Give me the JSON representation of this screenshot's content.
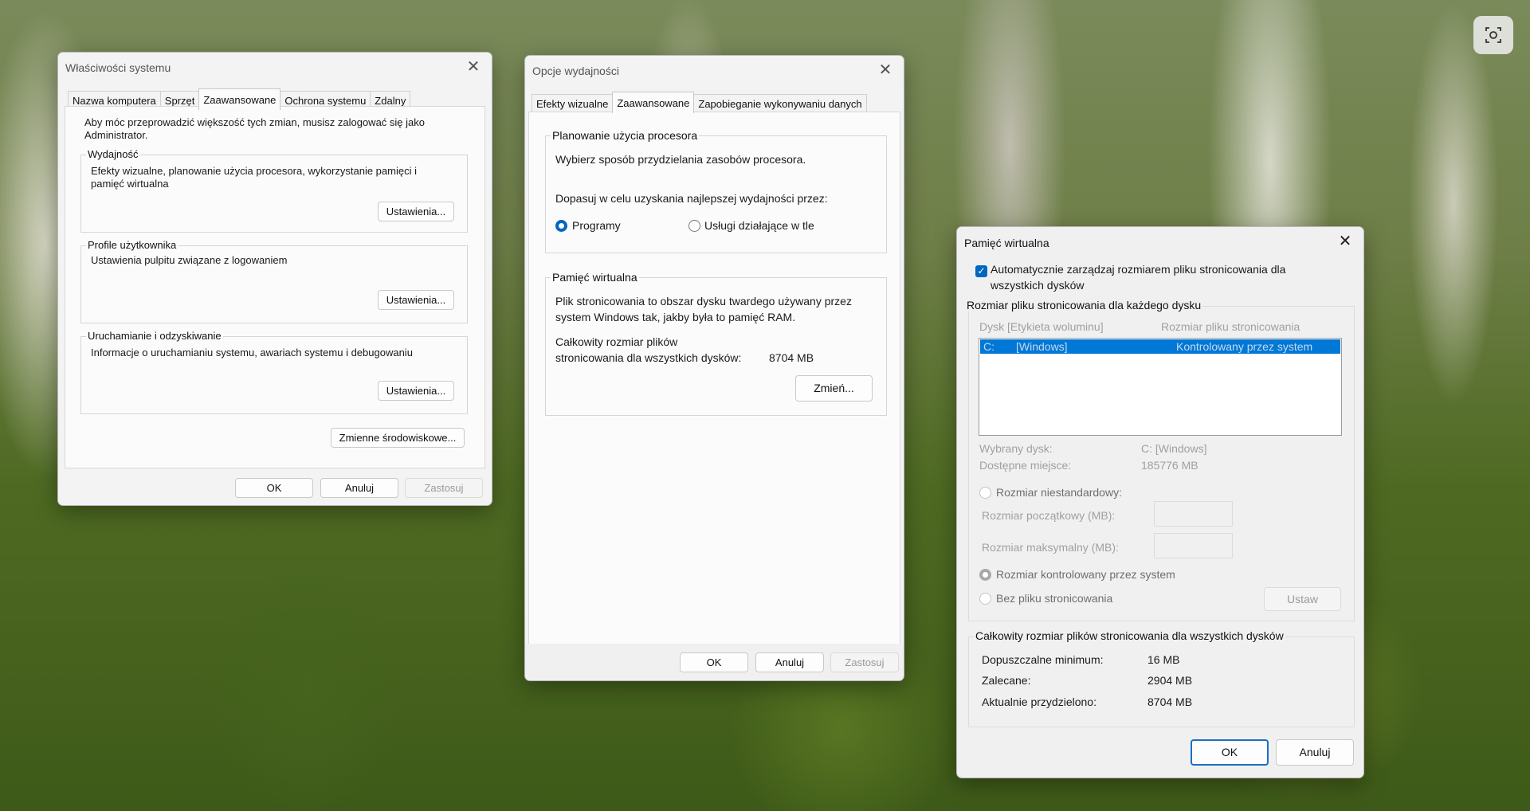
{
  "system_props": {
    "title": "Właściwości systemu",
    "tabs": [
      "Nazwa komputera",
      "Sprzęt",
      "Zaawansowane",
      "Ochrona systemu",
      "Zdalny"
    ],
    "admin_note": "Aby móc przeprowadzić większość tych zmian, musisz zalogować się jako Administrator.",
    "performance": {
      "legend": "Wydajność",
      "desc": "Efekty wizualne, planowanie użycia procesora, wykorzystanie pamięci i pamięć wirtualna",
      "button": "Ustawienia..."
    },
    "profiles": {
      "legend": "Profile użytkownika",
      "desc": "Ustawienia pulpitu związane z logowaniem",
      "button": "Ustawienia..."
    },
    "startup": {
      "legend": "Uruchamianie i odzyskiwanie",
      "desc": "Informacje o uruchamianiu systemu, awariach systemu i debugowaniu",
      "button": "Ustawienia..."
    },
    "env_button": "Zmienne środowiskowe...",
    "ok": "OK",
    "cancel": "Anuluj",
    "apply": "Zastosuj"
  },
  "perf_options": {
    "title": "Opcje wydajności",
    "tabs": [
      "Efekty wizualne",
      "Zaawansowane",
      "Zapobieganie wykonywaniu danych"
    ],
    "cpu": {
      "legend": "Planowanie użycia procesora",
      "desc": "Wybierz sposób przydzielania zasobów procesora.",
      "adjust": "Dopasuj w celu uzyskania najlepszej wydajności przez:",
      "opt_programs": "Programy",
      "opt_services": "Usługi działające w tle"
    },
    "vmem": {
      "legend": "Pamięć wirtualna",
      "desc_line1": "Plik stronicowania to obszar dysku twardego używany przez",
      "desc_line2": "system Windows tak, jakby była to pamięć RAM.",
      "total_line1": "Całkowity rozmiar plików",
      "total_line2": "stronicowania dla wszystkich dysków:",
      "total_value": "8704  MB",
      "change_button": "Zmień..."
    },
    "ok": "OK",
    "cancel": "Anuluj",
    "apply": "Zastosuj"
  },
  "virtual_mem": {
    "title": "Pamięć wirtualna",
    "auto_line1": "Automatycznie zarządzaj rozmiarem pliku stronicowania dla",
    "auto_line2": "wszystkich dysków",
    "per_drive_legend": "Rozmiar pliku stronicowania dla każdego dysku",
    "col_drive": "Dysk [Etykieta woluminu]",
    "col_size": "Rozmiar pliku stronicowania",
    "row_drive": "C:",
    "row_label": "[Windows]",
    "row_size": "Kontrolowany przez system",
    "selected_drive_label": "Wybrany dysk:",
    "selected_drive_value": "C:  [Windows]",
    "free_space_label": "Dostępne miejsce:",
    "free_space_value": "185776  MB",
    "custom_size": "Rozmiar niestandardowy:",
    "initial_size": "Rozmiar początkowy (MB):",
    "max_size": "Rozmiar maksymalny (MB):",
    "system_managed": "Rozmiar kontrolowany przez system",
    "no_paging": "Bez pliku stronicowania",
    "set_button": "Ustaw",
    "totals_legend": "Całkowity rozmiar plików stronicowania dla wszystkich dysków",
    "min_label": "Dopuszczalne minimum:",
    "min_value": "16  MB",
    "rec_label": "Zalecane:",
    "rec_value": "2904  MB",
    "cur_label": "Aktualnie przydzielono:",
    "cur_value": "8704  MB",
    "ok": "OK",
    "cancel": "Anuluj"
  }
}
